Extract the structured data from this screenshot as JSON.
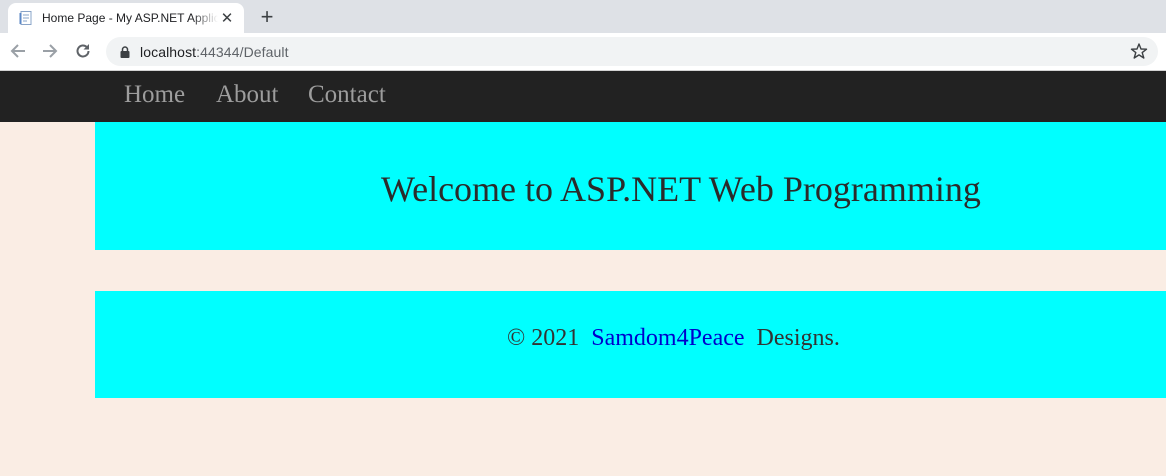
{
  "browser": {
    "tab_title": "Home Page - My ASP.NET Application",
    "tab_close_glyph": "✕",
    "new_tab_glyph": "+",
    "url_host": "localhost",
    "url_rest": ":44344/Default"
  },
  "navbar": {
    "links": [
      "Home",
      "About",
      "Contact"
    ],
    "background": "#222222",
    "link_color": "#9d9d9d"
  },
  "jumbotron": {
    "title": "Welcome to ASP.NET Web Programming",
    "background": "#00ffff"
  },
  "footer": {
    "prefix": "© 2021",
    "link_text": "Samdom4Peace",
    "suffix": "Designs.",
    "link_color": "#0000cc"
  },
  "page": {
    "background": "#faede4"
  },
  "icons": {
    "favicon": "page-icon",
    "back": "arrow-left-icon",
    "forward": "arrow-right-icon",
    "reload": "reload-icon",
    "lock": "lock-icon",
    "bookmark": "star-icon"
  }
}
